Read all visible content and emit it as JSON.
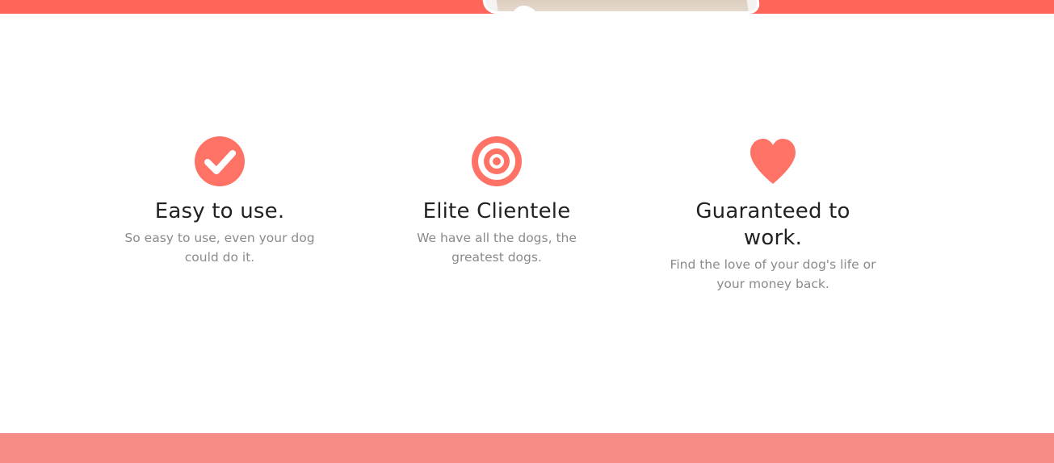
{
  "colors": {
    "accent": "#ff7367",
    "top_band": "#ff6559",
    "bottom_band": "#f68c85",
    "heading": "#222222",
    "body_text": "#8a8a8a"
  },
  "features": [
    {
      "icon": "check-circle-icon",
      "title": "Easy to use.",
      "description": "So easy to use, even your dog could do it."
    },
    {
      "icon": "target-icon",
      "title": "Elite Clientele",
      "description": "We have all the dogs, the greatest dogs."
    },
    {
      "icon": "heart-icon",
      "title": "Guaranteed to work.",
      "description": "Find the love of your dog's life or your money back."
    }
  ]
}
